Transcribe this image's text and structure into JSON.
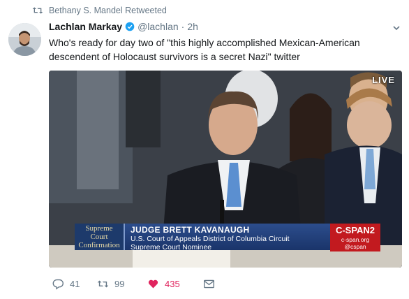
{
  "retweet": {
    "label": "Bethany S. Mandel Retweeted"
  },
  "tweet": {
    "name": "Lachlan Markay",
    "handle": "@lachlan",
    "separator": "·",
    "time": "2h",
    "text": "Who's ready for day two of \"this highly accomplished Mexican-American descendent of Holocaust survivors is a secret Nazi\" twitter"
  },
  "media": {
    "live_label": "LIVE",
    "lower_third": {
      "box_line1": "Supreme",
      "box_line2": "Court",
      "box_line3": "Confirmation",
      "name": "JUDGE BRETT KAVANAUGH",
      "line1": "U.S. Court of Appeals District of Columbia Circuit",
      "line2": "Supreme Court Nominee"
    },
    "network": {
      "logo": "C-SPAN2",
      "url": "c-span.org",
      "social": "@cspan"
    }
  },
  "actions": {
    "reply_count": "41",
    "retweet_count": "99",
    "like_count": "435"
  },
  "colors": {
    "like": "#e0245e",
    "verified": "#1da1f2",
    "meta": "#657786"
  }
}
